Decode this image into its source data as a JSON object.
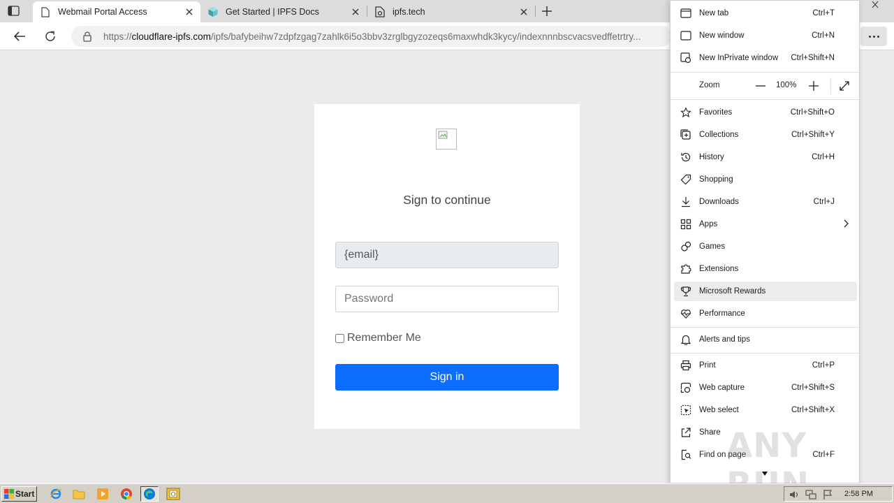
{
  "browser": {
    "tabs": [
      {
        "title": "Webmail Portal Access",
        "active": true
      },
      {
        "title": "Get Started | IPFS Docs",
        "active": false
      },
      {
        "title": "ipfs.tech",
        "active": false
      }
    ],
    "address": {
      "scheme": "https://",
      "host": "cloudflare-ipfs.com",
      "path": "/ipfs/bafybeihw7zdpfzgag7zahlk6i5o3bbv3zrglbgyzozeqs6maxwhdk3kycy/indexnnnbscvacsvedffetrtry..."
    }
  },
  "page": {
    "heading": "Sign to continue",
    "email_value": "{email}",
    "password_placeholder": "Password",
    "remember_label": "Remember Me",
    "signin_label": "Sign in"
  },
  "menu": {
    "items": [
      {
        "label": "New tab",
        "shortcut": "Ctrl+T",
        "icon": "new-tab-icon"
      },
      {
        "label": "New window",
        "shortcut": "Ctrl+N",
        "icon": "new-window-icon"
      },
      {
        "label": "New InPrivate window",
        "shortcut": "Ctrl+Shift+N",
        "icon": "inprivate-icon"
      },
      {
        "label": "Favorites",
        "shortcut": "Ctrl+Shift+O",
        "icon": "star-icon"
      },
      {
        "label": "Collections",
        "shortcut": "Ctrl+Shift+Y",
        "icon": "collections-icon"
      },
      {
        "label": "History",
        "shortcut": "Ctrl+H",
        "icon": "history-icon"
      },
      {
        "label": "Shopping",
        "shortcut": "",
        "icon": "tag-icon"
      },
      {
        "label": "Downloads",
        "shortcut": "Ctrl+J",
        "icon": "download-icon"
      },
      {
        "label": "Apps",
        "shortcut": "",
        "icon": "apps-icon"
      },
      {
        "label": "Games",
        "shortcut": "",
        "icon": "games-icon"
      },
      {
        "label": "Extensions",
        "shortcut": "",
        "icon": "puzzle-icon"
      },
      {
        "label": "Microsoft Rewards",
        "shortcut": "",
        "icon": "trophy-icon"
      },
      {
        "label": "Performance",
        "shortcut": "",
        "icon": "heartbeat-icon"
      },
      {
        "label": "Alerts and tips",
        "shortcut": "",
        "icon": "bell-icon"
      },
      {
        "label": "Print",
        "shortcut": "Ctrl+P",
        "icon": "printer-icon"
      },
      {
        "label": "Web capture",
        "shortcut": "Ctrl+Shift+S",
        "icon": "capture-icon"
      },
      {
        "label": "Web select",
        "shortcut": "Ctrl+Shift+X",
        "icon": "select-icon"
      },
      {
        "label": "Share",
        "shortcut": "",
        "icon": "share-icon"
      },
      {
        "label": "Find on page",
        "shortcut": "Ctrl+F",
        "icon": "find-icon"
      }
    ],
    "zoom": {
      "label": "Zoom",
      "value": "100%"
    }
  },
  "watermark": "ANY RUN",
  "taskbar": {
    "start_label": "Start",
    "clock": "2:58 PM"
  },
  "colors": {
    "accent": "#0d6efd",
    "menu_highlight": "#ececec"
  }
}
